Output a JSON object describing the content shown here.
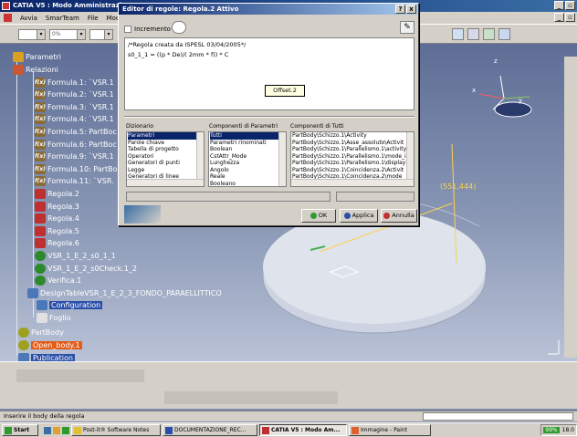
{
  "window": {
    "title": "CATIA V5 : Modo Amministrazi"
  },
  "menubar": {
    "items": [
      "Avvia",
      "SmarTeam",
      "File",
      "Modif"
    ]
  },
  "toolbar": {
    "combo1": "",
    "combo2": "0%"
  },
  "tree": {
    "parametri": "Parametri",
    "relazioni": "Relazioni",
    "items": [
      {
        "label": "Formula.1: `VSR.1",
        "type": "fx"
      },
      {
        "label": "Formula.2: `VSR.1",
        "type": "fx"
      },
      {
        "label": "Formula.3: `VSR.1",
        "type": "fx"
      },
      {
        "label": "Formula.4: `VSR.1",
        "type": "fx"
      },
      {
        "label": "Formula.5: PartBoc",
        "type": "fx"
      },
      {
        "label": "Formula.6: PartBoc",
        "type": "fx"
      },
      {
        "label": "Formula.9: `VSR.1",
        "type": "fx"
      },
      {
        "label": "Formula.10: PartBo",
        "type": "fx"
      },
      {
        "label": "Formula.11: `VSR.",
        "type": "fx"
      },
      {
        "label": "Regola.2",
        "type": "rule"
      },
      {
        "label": "Regola.3",
        "type": "rule"
      },
      {
        "label": "Regola.4",
        "type": "rule"
      },
      {
        "label": "Regola.5",
        "type": "rule"
      },
      {
        "label": "Regola.6",
        "type": "rule"
      },
      {
        "label": "VSR_1_E_2_s0_1_1",
        "type": "check"
      },
      {
        "label": "VSR_1_E_2_s0Check.1_2",
        "type": "check"
      },
      {
        "label": "Verifica.1",
        "type": "check"
      },
      {
        "label": "DesignTableVSR_1_E_2_3_FONDO_PARAELLITTICO",
        "type": "design"
      }
    ],
    "configuration": "Configuration",
    "foglio": "Foglio",
    "partbody": "PartBody",
    "open_body": "Open_body.1",
    "publication": "Publication"
  },
  "viewport": {
    "dimension": "(551,444)"
  },
  "dialog": {
    "title": "Editor di regole: Regola.2 Attivo",
    "incremental_label": "Incremento",
    "code_line1": "/*Regola creata da ISPESL 03/04/2005*/",
    "code_line2": "s0_1_1 = ((p * De)/( 2mm * f)) * C",
    "tooltip": "Offset.2",
    "col1_header": "Dizionario",
    "col2_header": "Componenti di Parametri",
    "col3_header": "Componenti di Tutti",
    "dictionary": [
      "Parametri",
      "Parole chiave",
      "Tabella di progetto",
      "Operatori",
      "Generatori di punti",
      "Legge",
      "Generatori di linee"
    ],
    "components": [
      "Tutti",
      "Parametri rinominati",
      "Boolean",
      "CstAttr_Mode",
      "Lunghezza",
      "Angolo",
      "Reale",
      "Booleano"
    ],
    "all_components": [
      "PartBody\\Schizzo.1\\Activity",
      "PartBody\\Schizzo.1\\Asse_assoluto\\Activit",
      "PartBody\\Schizzo.1\\Parallelismo.1\\activity",
      "PartBody\\Schizzo.1\\Parallelismo.1\\mode_i",
      "PartBody\\Schizzo.1\\Parallelismo.1\\display",
      "PartBody\\Schizzo.1\\Coincidenza.2\\Activit",
      "PartBody\\Schizzo.1\\Coincidenza.2\\mode"
    ],
    "ok_label": "OK",
    "apply_label": "Applica",
    "cancel_label": "Annulla"
  },
  "status": {
    "text": "Inserire il body della regola"
  },
  "taskbar": {
    "start": "Start",
    "buttons": [
      "Post-it® Software Notes",
      "DOCUMENTAZIONE_REC...",
      "CATIA V5 : Modo Am...",
      "Immagine - Paint"
    ],
    "zoom": "99%",
    "clock": "18.0"
  }
}
